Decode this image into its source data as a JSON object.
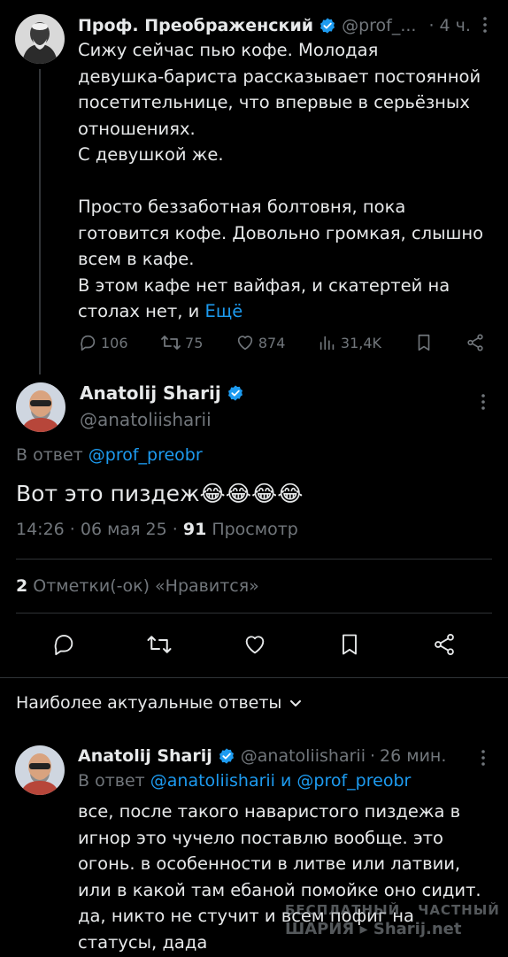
{
  "parent_tweet": {
    "author_name": "Проф. Преображенский",
    "handle": "@prof_...",
    "separator": "·",
    "time": "4 ч.",
    "text": "Сижу сейчас пью кофе. Молодая\nдевушка-бариста рассказывает постоянной\nпосетительнице, что впервые в серьёзных\nотношениях.\nС девушкой же.\n\nПросто беззаботная болтовня, пока\nготовится кофе. Довольно громкая, слышно\nвсем в кафе.\nВ этом кафе нет вайфая, и скатертей на\nстолах нет, и ",
    "more_link": "Ещё",
    "replies": "106",
    "reposts": "75",
    "likes": "874",
    "views": "31,4K"
  },
  "main_tweet": {
    "author_name": "Anatolij Sharij",
    "handle": "@anatoliisharii",
    "reply_prefix": "В ответ ",
    "reply_handle": "@prof_preobr",
    "text": "Вот это пиздеж😂😂😂😂",
    "time": "14:26 · 06 мая 25 · ",
    "views_count": "91",
    "views_label": " Просмотр",
    "likes_count": "2",
    "likes_label": " Отметки(-ок) «Нравится»"
  },
  "relevant_replies_label": "Наиболее актуальные ответы",
  "reply_tweet": {
    "author_name": "Anatolij Sharij",
    "handle": "@anatoliisharii",
    "separator": "·",
    "time": "26 мин.",
    "reply_prefix": "В ответ ",
    "reply_handle_1": "@anatoliisharii",
    "reply_joiner": " и ",
    "reply_handle_2": "@prof_preobr",
    "text": "все, после такого наваристого пиздежа в\nигнор это чучело поставлю вообще. это\nогонь. в особенности в литве или латвии,\nили в какой там ебаной помойке оно сидит.\nда, никто не стучит и всем пофиг на\nстатусы, дада"
  },
  "watermark": {
    "line1_a": "БЕСПЛАТНЫЙ",
    "line1_b": "ЧАСТНЫЙ",
    "line2": "ШАРИЯ ▸ Sharij.net"
  },
  "colors": {
    "background": "#000000",
    "text": "#e7e9ea",
    "muted": "#71767b",
    "link": "#1d9bf0",
    "verified": "#1d9bf0",
    "divider": "#2f3336"
  },
  "icons": [
    "verified-badge-icon",
    "reply-icon",
    "repost-icon",
    "like-icon",
    "views-icon",
    "bookmark-icon",
    "share-icon",
    "more-icon",
    "chevron-down-icon"
  ]
}
